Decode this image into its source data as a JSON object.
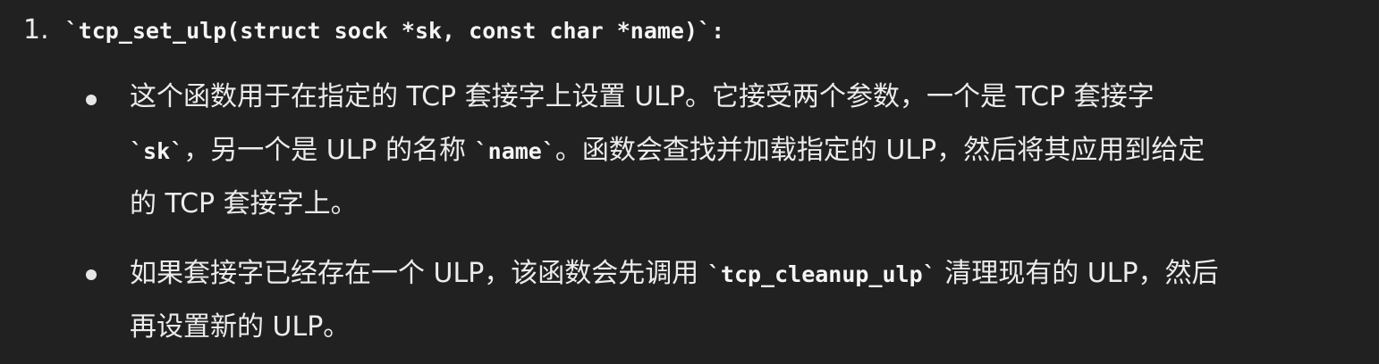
{
  "list_item": {
    "number": "1.",
    "signature": "`tcp_set_ulp(struct sock *sk, const char *name)`",
    "colon": ":"
  },
  "bullet1": {
    "l1": "这个函数用于在指定的 TCP 套接字上设置 ULP。它接受两个参数，一个是 TCP 套接字",
    "l2a_code": "`sk`",
    "l2b": "，另一个是 ULP 的名称 ",
    "l2c_code": "`name`",
    "l2d": "。函数会查找并加载指定的 ULP，然后将其应用到给定",
    "l3": "的 TCP 套接字上。"
  },
  "bullet2": {
    "l1a": "如果套接字已经存在一个 ULP，该函数会先调用 ",
    "l1b_code": "`tcp_cleanup_ulp`",
    "l1c": " 清理现有的 ULP，然后",
    "l2": "再设置新的 ULP。"
  }
}
